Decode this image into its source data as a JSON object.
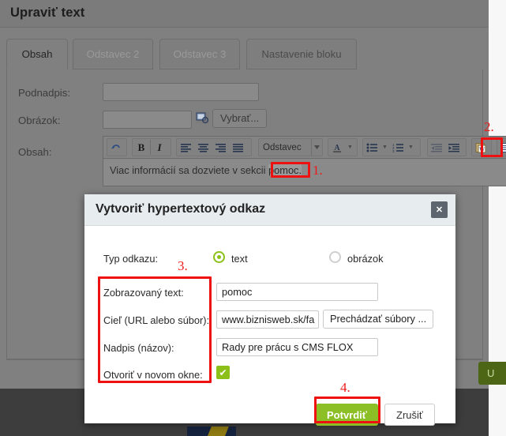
{
  "page": {
    "title": "Upraviť text",
    "tabs": [
      {
        "label": "Obsah",
        "state": "active"
      },
      {
        "label": "Odstavec 2",
        "state": "disabled"
      },
      {
        "label": "Odstavec 3",
        "state": "disabled"
      },
      {
        "label": "Nastavenie bloku",
        "state": "normal"
      }
    ],
    "fields": {
      "subtitle_label": "Podnadpis:",
      "subtitle_value": "",
      "image_label": "Obrázok:",
      "image_value": "",
      "image_pick_button": "Vybrať...",
      "content_label": "Obsah:"
    },
    "editor": {
      "format_select": "Odstavec",
      "text_before": "Viac informácií sa dozviete v sekcii ",
      "text_selected": "pomoc.",
      "toolbar_icons": [
        "undo-icon",
        "bold-icon",
        "italic-icon",
        "align-left-icon",
        "align-center-icon",
        "align-right-icon",
        "align-justify-icon",
        "font-color-icon",
        "bullet-list-icon",
        "numbered-list-icon",
        "outdent-icon",
        "indent-icon",
        "paste-from-word-icon",
        "edit-source-icon",
        "insert-link-icon",
        "unlink-icon"
      ]
    },
    "save_button": "U"
  },
  "annotations": {
    "step1": "1.",
    "step2": "2.",
    "step3": "3.",
    "step4": "4."
  },
  "modal": {
    "title": "Vytvoriť hypertextový odkaz",
    "close_label": "✕",
    "link_type_label": "Typ odkazu:",
    "link_type_options": [
      {
        "label": "text",
        "selected": true
      },
      {
        "label": "obrázok",
        "selected": false
      }
    ],
    "rows": [
      {
        "label": "Zobrazovaný text:",
        "value": "pomoc"
      },
      {
        "label": "Cieľ (URL alebo súbor):",
        "value": "www.biznisweb.sk/fa"
      },
      {
        "label": "Nadpis (názov):",
        "value": "Rady pre prácu s CMS FLOX"
      },
      {
        "label": "Otvoriť v novom okne:",
        "value": ""
      }
    ],
    "browse_button": "Prechádzať súbory ...",
    "checkbox_checked": true,
    "checkbox_glyph": "✔",
    "confirm_button": "Potvrdiť",
    "cancel_button": "Zrušiť"
  },
  "colors": {
    "accent_green": "#8cbf26",
    "annotation_red": "#ee1111",
    "modal_header": "#e7ecef",
    "save_green": "#4d6615"
  }
}
